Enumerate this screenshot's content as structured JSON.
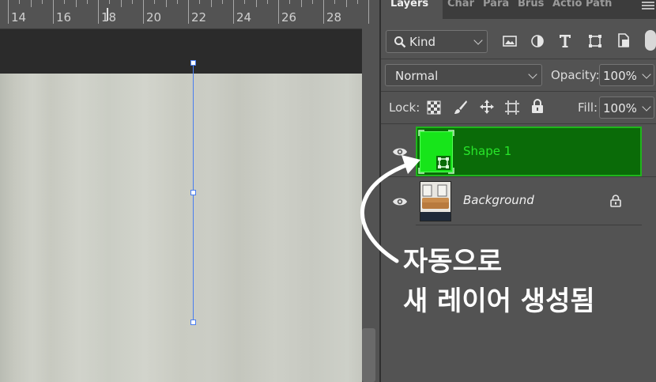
{
  "ruler": {
    "labels": [
      "14",
      "16",
      "18",
      "20",
      "22",
      "24",
      "26",
      "28"
    ]
  },
  "panel_tabs": [
    "Layers",
    "Char",
    "Para",
    "Brus",
    "Actio",
    "Path"
  ],
  "filter": {
    "label": "Kind"
  },
  "blend": {
    "mode": "Normal",
    "opacity_label": "Opacity:",
    "opacity_value": "100%"
  },
  "lock": {
    "label": "Lock:",
    "fill_label": "Fill:",
    "fill_value": "100%"
  },
  "layers": [
    {
      "name": "Shape 1",
      "visible": true,
      "selected": true
    },
    {
      "name": "Background",
      "visible": true,
      "locked": true
    }
  ],
  "annotation": {
    "line1": "자동으로",
    "line2": "새 레이어 생성됨"
  },
  "colors": {
    "selection_green": "#0a6b08",
    "path_blue": "#4a7ef0",
    "panel_bg": "#535353"
  }
}
